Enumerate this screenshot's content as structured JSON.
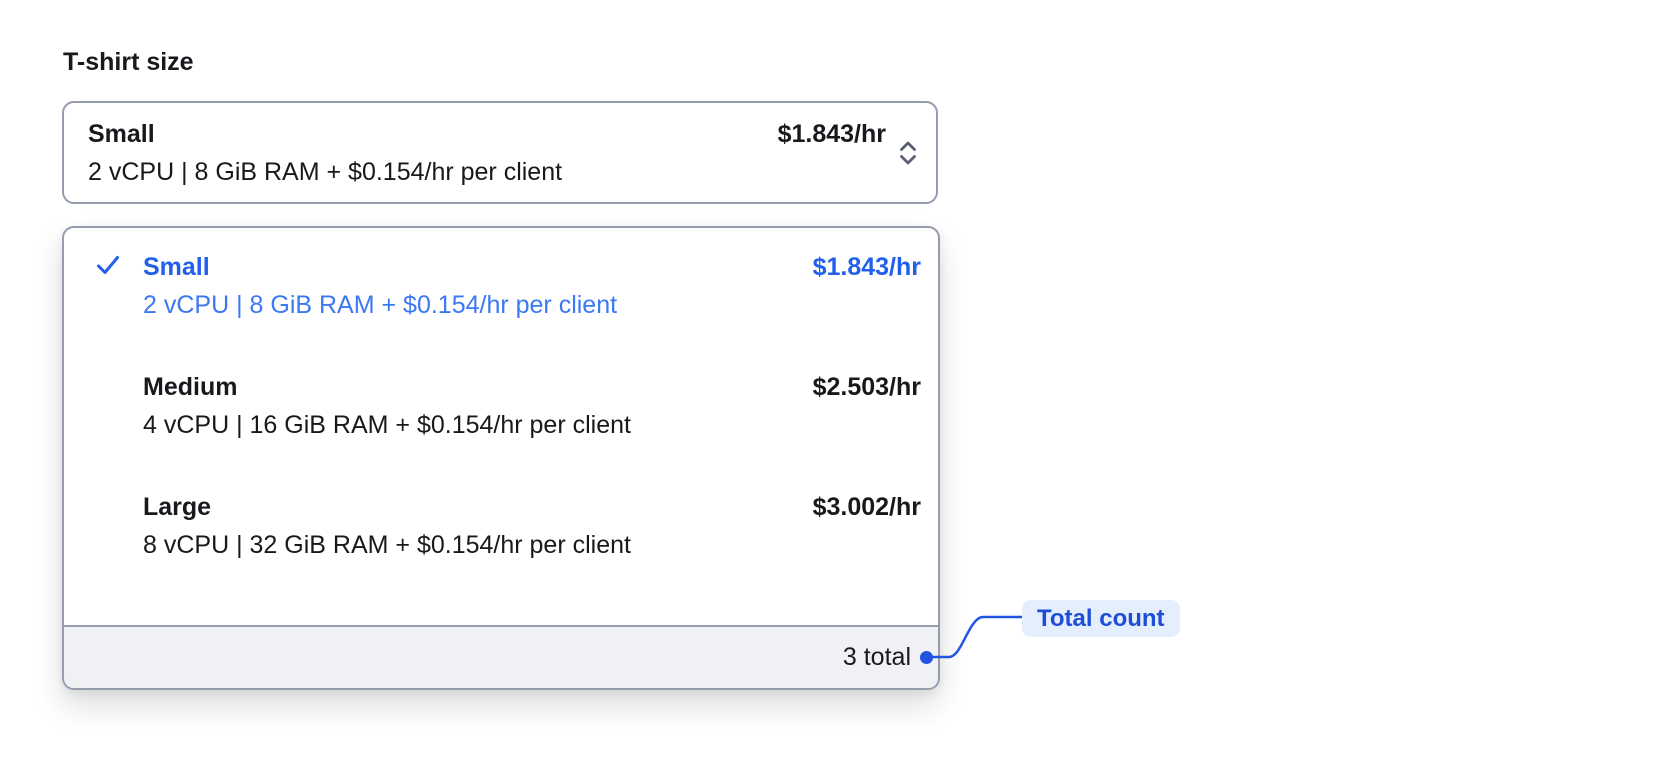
{
  "field": {
    "label": "T-shirt size"
  },
  "select": {
    "value": {
      "name": "Small",
      "description": "2 vCPU | 8 GiB RAM + $0.154/hr per client",
      "price": "$1.843/hr"
    },
    "chevron_icon": "chevron-up-down-icon"
  },
  "dropdown": {
    "options": [
      {
        "name": "Small",
        "description": "2 vCPU | 8 GiB RAM + $0.154/hr per client",
        "price": "$1.843/hr",
        "selected": true,
        "icon": "check-icon"
      },
      {
        "name": "Medium",
        "description": "4 vCPU | 16 GiB RAM + $0.154/hr per client",
        "price": "$2.503/hr",
        "selected": false
      },
      {
        "name": "Large",
        "description": "8 vCPU | 32 GiB RAM + $0.154/hr per client",
        "price": "$3.002/hr",
        "selected": false
      }
    ],
    "footer": {
      "total": "3 total"
    }
  },
  "annotation": {
    "label": "Total count",
    "marker": "dot"
  },
  "colors": {
    "accent_blue": "#2160eb",
    "accent_blue_light": "#3b78f3",
    "annotation_blue": "#2254e4",
    "annotation_text": "#1d4ed8",
    "annotation_bg": "#e5eefc",
    "border_gray": "#949cae",
    "footer_bg": "#f0f1f4",
    "text_dark": "#17191d",
    "chevron_gray": "#596070"
  }
}
